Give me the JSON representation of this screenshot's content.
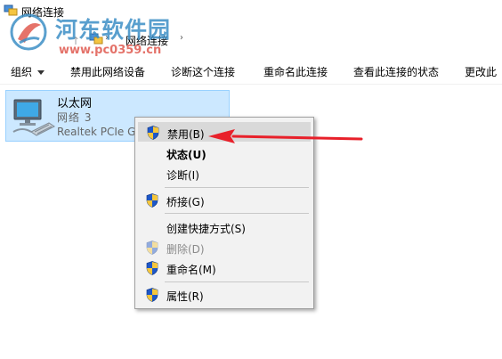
{
  "window": {
    "title": "网络连接"
  },
  "watermark": {
    "name": "河东软件园",
    "url": "www.pc0359.cn"
  },
  "address": {
    "crumb": "网络连接",
    "separator": "›"
  },
  "toolbar": {
    "organize_label": "组织",
    "disable_label": "禁用此网络设备",
    "diagnose_label": "诊断这个连接",
    "rename_label": "重命名此连接",
    "status_label": "查看此连接的状态",
    "change_label": "更改此"
  },
  "adapter": {
    "name": "以太网",
    "network": "网络 3",
    "device": "Realtek PCIe GI"
  },
  "context_menu": {
    "items": [
      {
        "label": "禁用(B)",
        "shield": true
      },
      {
        "label": "状态(U)",
        "shield": false,
        "bold": true
      },
      {
        "label": "诊断(I)",
        "shield": false
      },
      {
        "label": "桥接(G)",
        "shield": true
      },
      {
        "label": "创建快捷方式(S)",
        "shield": false
      },
      {
        "label": "删除(D)",
        "shield": true,
        "disabled": true
      },
      {
        "label": "重命名(M)",
        "shield": true
      },
      {
        "label": "属性(R)",
        "shield": true
      }
    ]
  },
  "colors": {
    "selection": "#cce8ff",
    "selection_border": "#99d1ff",
    "menu_bg": "#f2f2f2",
    "menu_hover": "#d9d9d9",
    "annotation": "#e8202a",
    "watermark_blue": "#3d8fc6",
    "watermark_red": "#e05a50"
  },
  "icons": {
    "app": "network-connections-icon",
    "adapter": "ethernet-adapter-icon",
    "shield": "uac-shield-icon"
  }
}
